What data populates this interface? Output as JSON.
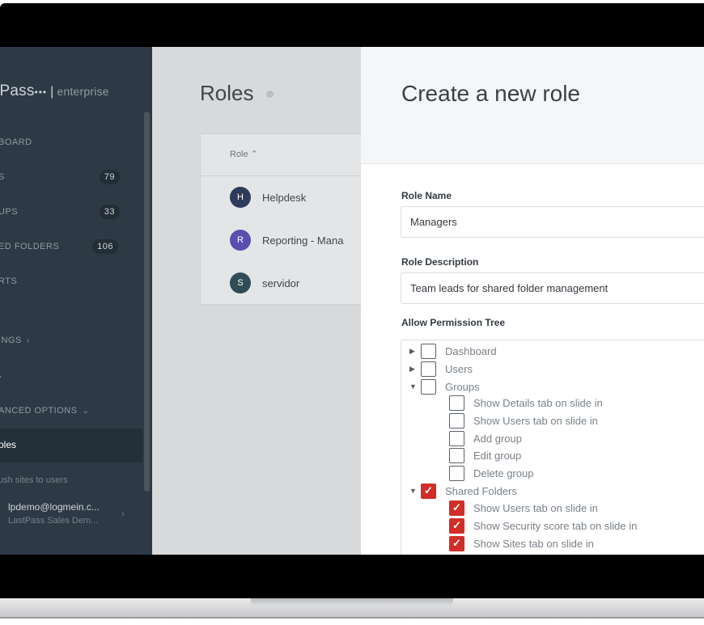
{
  "sidebar": {
    "logo": {
      "brand": "tPass",
      "dots": "•••",
      "sep": "|",
      "edition": "enterprise"
    },
    "items": [
      {
        "label": "BOARD",
        "count": ""
      },
      {
        "label": "S",
        "count": "79"
      },
      {
        "label": "UPS",
        "count": "33"
      },
      {
        "label": "ED FOLDERS",
        "count": "106"
      },
      {
        "label": "RTS",
        "count": ""
      },
      {
        "label": "INGS",
        "chevron": "›"
      },
      {
        "label": "›"
      },
      {
        "label": "ANCED OPTIONS",
        "chevron": "⌄"
      }
    ],
    "active_item": "oles",
    "sub_item": "ush sites to users",
    "user": {
      "email": "lpdemo@logmein.c...",
      "org": "LastPass Sales Dem...",
      "chevron": "›"
    }
  },
  "roles_page": {
    "title": "Roles",
    "column_header": "Role ⌃",
    "rows": [
      {
        "initial": "H",
        "label": "Helpdesk",
        "color": "#2e3b5b"
      },
      {
        "initial": "R",
        "label": "Reporting - Mana",
        "color": "#5a4fb0"
      },
      {
        "initial": "S",
        "label": "servidor",
        "color": "#2f4c57"
      }
    ]
  },
  "panel": {
    "title": "Create a new role",
    "role_name_label": "Role Name",
    "role_name_value": "Managers",
    "role_description_label": "Role Description",
    "role_description_value": "Team leads for shared folder management",
    "tree_label": "Allow Permission Tree",
    "tree": [
      {
        "label": "Dashboard",
        "arrow": "▶",
        "checked": false,
        "level": 0
      },
      {
        "label": "Users",
        "arrow": "▶",
        "checked": false,
        "level": 0
      },
      {
        "label": "Groups",
        "arrow": "▼",
        "checked": false,
        "level": 0
      },
      {
        "label": "Show Details tab on slide in",
        "arrow": "",
        "checked": false,
        "level": 1
      },
      {
        "label": "Show Users tab on slide in",
        "arrow": "",
        "checked": false,
        "level": 1
      },
      {
        "label": "Add group",
        "arrow": "",
        "checked": false,
        "level": 1
      },
      {
        "label": "Edit group",
        "arrow": "",
        "checked": false,
        "level": 1
      },
      {
        "label": "Delete group",
        "arrow": "",
        "checked": false,
        "level": 1
      },
      {
        "label": "Shared Folders",
        "arrow": "▼",
        "checked": true,
        "level": 0
      },
      {
        "label": "Show Users tab on slide in",
        "arrow": "",
        "checked": true,
        "level": 1
      },
      {
        "label": "Show Security score tab on slide in",
        "arrow": "",
        "checked": true,
        "level": 1
      },
      {
        "label": "Show Sites tab on slide in",
        "arrow": "",
        "checked": true,
        "level": 1
      }
    ],
    "check_glyph": "✓"
  },
  "colors": {
    "accent_red": "#d32d27",
    "sidebar_bg": "#2d3944"
  }
}
